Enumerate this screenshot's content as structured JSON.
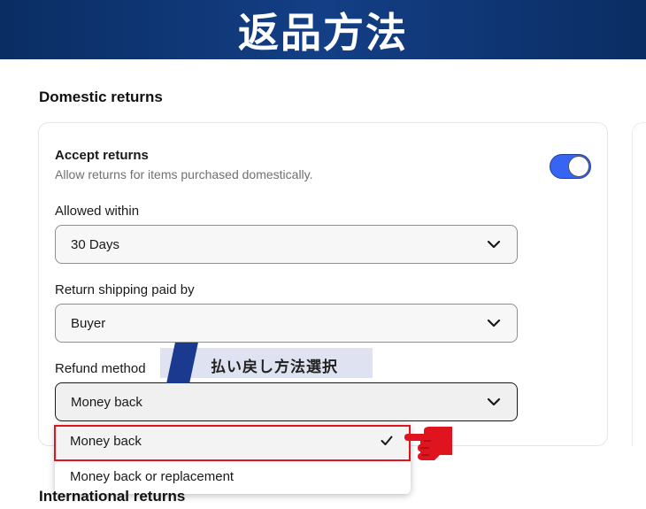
{
  "banner": {
    "title": "返品方法"
  },
  "domestic": {
    "section_title": "Domestic returns",
    "accept": {
      "title": "Accept returns",
      "description": "Allow returns for items purchased domestically.",
      "enabled": true
    },
    "allowed_within": {
      "label": "Allowed within",
      "value": "30 Days"
    },
    "shipping_paid_by": {
      "label": "Return shipping paid by",
      "value": "Buyer"
    },
    "refund_method": {
      "label": "Refund method",
      "value": "Money back",
      "options": [
        {
          "label": "Money back",
          "selected": true
        },
        {
          "label": "Money back or replacement",
          "selected": false
        }
      ]
    }
  },
  "international": {
    "section_title": "International returns"
  },
  "annotation": {
    "text": "払い戻し方法選択"
  },
  "colors": {
    "banner": "#0a2d63",
    "toggle_on": "#3665f3",
    "highlight": "#e0141e",
    "annotation_stripe": "#1a3a8f"
  },
  "icons": {
    "chevron": "chevron-down-icon",
    "check": "check-icon",
    "hand": "pointing-hand-icon"
  }
}
